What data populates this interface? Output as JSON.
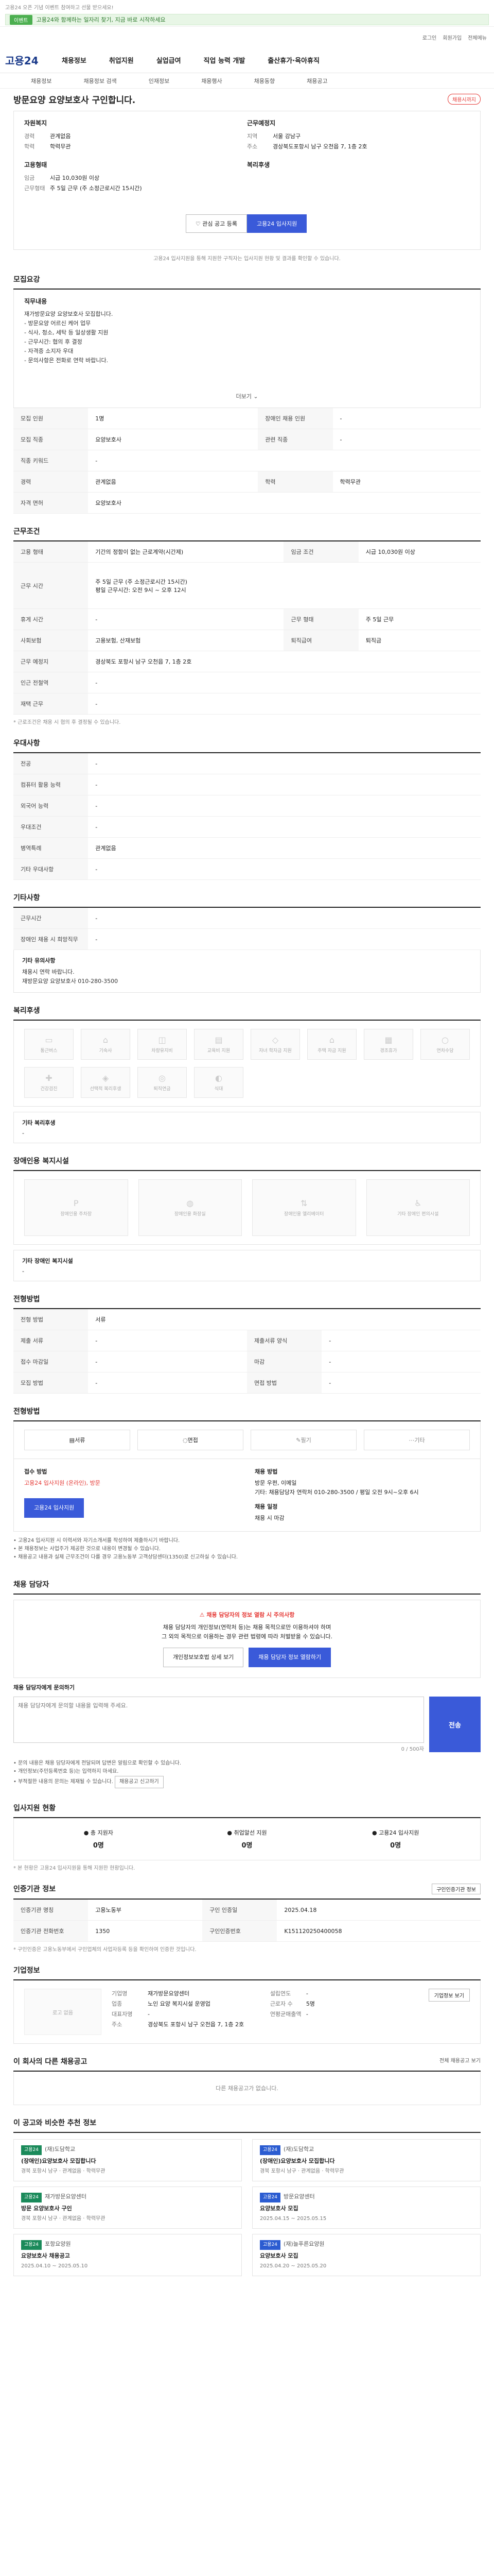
{
  "banner": {
    "notice": "고용24 오픈 기념 이벤트 참여하고 선물 받으세요!",
    "tag": "이벤트",
    "text": "고용24와 함께하는 일자리 찾기, 지금 바로 시작하세요"
  },
  "util": {
    "login": "로그인",
    "join": "회원가입",
    "sitemap": "전체메뉴"
  },
  "gnb": {
    "logo": "고용24",
    "menu": [
      "채용정보",
      "취업지원",
      "실업급여",
      "직업 능력 개발",
      "출산휴가·육아휴직"
    ],
    "sub": [
      "채용정보",
      "채용정보 검색",
      "인재정보",
      "채용행사",
      "채용동향",
      "채용공고"
    ]
  },
  "job": {
    "title": "방문요양 요양보호사 구인합니다.",
    "badge": "채용시까지",
    "left_head": "자원복지",
    "left": [
      {
        "k": "경력",
        "v": "관계없음"
      },
      {
        "k": "학력",
        "v": "학력무관"
      }
    ],
    "left_head2": "고용형태",
    "left2": [
      {
        "k": "임금",
        "v": "시급 10,030원 이상"
      },
      {
        "k": "근무형태",
        "v": "주 5일 근무 (주 소정근로시간 15시간)"
      }
    ],
    "right_head": "근무예정지",
    "right": [
      {
        "k": "지역",
        "v": "서울 강남구"
      },
      {
        "k": "주소",
        "v": "경상북도포항시 남구 오천읍 7, 1층 2호"
      }
    ],
    "right_head2": "복리후생",
    "apply_save": "관심 공고 등록",
    "apply_now": "고용24 입사지원",
    "note": "고용24 입사지원을 통해 지원한 구직자는 입사지원 현황 및 결과를 확인할 수 있습니다."
  },
  "section_titles": {
    "detail": "모집요강",
    "condition": "근무조건",
    "special": "우대사항",
    "other": "기타사항",
    "welfare": "복리후생",
    "infra": "장애인용 복지시설",
    "process": "전형방법",
    "contact": "채용 담당자",
    "stats": "입사지원 현황",
    "recruit_info": "인증기관 정보",
    "company": "기업정보",
    "company_jobs": "이 회사의 다른 채용공고",
    "recommend": "이 공고와 비슷한 추천 정보"
  },
  "detail": {
    "sub": "직무내용",
    "text": "재가방문요양 요양보호사 모집합니다.\n - 방문요양 어르신 케어 업무\n - 식사, 청소, 세탁 등 일상생활 지원\n - 근무시간: 협의 후 결정\n - 자격증 소지자 우대\n - 문의사항은 전화로 연락 바랍니다.",
    "more": "더보기",
    "rows": [
      {
        "k": "모집 인원",
        "v": "1명",
        "k2": "장애인 채용 인원",
        "v2": "-"
      },
      {
        "k": "모집 직종",
        "v": "요양보호사",
        "k2": "관련 직종",
        "v2": "-"
      },
      {
        "k": "직종 키워드",
        "v": "-",
        "k2": "",
        "v2": ""
      },
      {
        "k": "경력",
        "v": "관계없음",
        "k2": "학력",
        "v2": "학력무관"
      },
      {
        "k": "자격 면허",
        "v": "요양보호사",
        "k2": "",
        "v2": ""
      }
    ]
  },
  "condition": {
    "rows": [
      {
        "k": "고용 형태",
        "v": "기간의 정함이 없는 근로계약(시간제)",
        "k2": "임금 조건",
        "v2": "시급 10,030원 이상"
      },
      {
        "k": "근무 시간",
        "v": "주 5일 근무 (주 소정근로시간 15시간)\n평일 근무시간: 오전 9시 ~ 오후 12시",
        "k2": "",
        "v2": ""
      },
      {
        "k": "휴게 시간",
        "v": "-",
        "k2": "근무 형태",
        "v2": "주 5일 근무"
      },
      {
        "k": "사회보험",
        "v": "고용보험, 산재보험",
        "k2": "퇴직급여",
        "v2": "퇴직금"
      },
      {
        "k": "근무 예정지",
        "v": "경상북도 포항시 남구 오천읍 7, 1층 2호",
        "k2": "",
        "v2": ""
      },
      {
        "k": "인근 전철역",
        "v": "-",
        "k2": "",
        "v2": ""
      },
      {
        "k": "재택 근무",
        "v": "-",
        "k2": "",
        "v2": ""
      }
    ],
    "note": "* 근로조건은 채용 시 협의 후 결정될 수 있습니다."
  },
  "special": {
    "rows": [
      {
        "k": "전공",
        "v": "-"
      },
      {
        "k": "컴퓨터 활용 능력",
        "v": "-"
      },
      {
        "k": "외국어 능력",
        "v": "-"
      },
      {
        "k": "우대조건",
        "v": "-"
      },
      {
        "k": "병역특례",
        "v": "관계없음"
      },
      {
        "k": "기타 우대사항",
        "v": "-"
      }
    ]
  },
  "other": {
    "rows": [
      {
        "k": "근무시간",
        "v": "-"
      },
      {
        "k": "장애인 채용 시 희망직무",
        "v": "-"
      }
    ],
    "extra_label": "기타 유의사항",
    "extra_text": "채용시 연락 바랍니다.\n재방문요양 요양보호사 010-280-3500"
  },
  "welfare": {
    "items": [
      "통근버스",
      "기숙사",
      "차량유지비",
      "교육비 지원",
      "자녀 학자금 지원",
      "주택 자금 지원",
      "경조휴가",
      "연차수당",
      "건강검진",
      "선택적 복리후생",
      "퇴직연금",
      "식대"
    ],
    "etc_label": "기타 복리후생",
    "etc": "-"
  },
  "infra": {
    "items": [
      "장애인용 주차장",
      "장애인용 화장실",
      "장애인용 엘리베이터",
      "기타 장애인 편의시설"
    ],
    "etc_label": "기타 장애인 복지시설",
    "etc": "-"
  },
  "process_rows": [
    {
      "k": "전형 방법",
      "v": "서류",
      "k2": "",
      "v2": ""
    },
    {
      "k": "제출 서류",
      "v": "-",
      "k2": "제출서류 양식",
      "v2": "-"
    },
    {
      "k": "접수 마감일",
      "v": "-",
      "k2": "마감",
      "v2": "-"
    },
    {
      "k": "모집 방법",
      "v": "-",
      "k2": "면접 방법",
      "v2": "-"
    }
  ],
  "process": {
    "steps": [
      "서류",
      "면접",
      "필기",
      "기타"
    ],
    "apply_method_label": "접수 방법",
    "apply_method": "고용24 입사지원 (온라인), 방문",
    "apply_btn": "고용24 입사지원",
    "submit_label": "채용 방법",
    "submit": "방문 우편, 이메일\n기타: 채용담당자 연락처 010-280-3500 / 평일 오전 9시~오후 6시",
    "date_label": "채용 일정",
    "date": "채용 시 마감",
    "bullets": [
      "고용24 입사지원 시 이력서와 자기소개서를 작성하여 제출하시기 바랍니다.",
      "본 채용정보는 사업주가 제공한 것으로 내용이 변경될 수 있습니다.",
      "채용공고 내용과 실제 근무조건이 다를 경우 고용노동부 고객상담센터(1350)로 신고하실 수 있습니다."
    ]
  },
  "contact": {
    "alert_title": "채용 담당자의 정보 열람 시 주의사항",
    "alert_text": "채용 담당자의 개인정보(연락처 등)는 채용 목적으로만 이용하셔야 하며\n그 외의 목적으로 이용하는 경우 관련 법령에 따라 처벌받을 수 있습니다.",
    "btn1": "개인정보보호법 상세 보기",
    "btn2": "채용 담당자 정보 열람하기",
    "inq_label": "채용 담당자에게 문의하기",
    "inq_placeholder": "채용 담당자에게 문의할 내용을 입력해 주세요.",
    "counter": "0 / 500자",
    "send": "전송",
    "bullets": [
      "문의 내용은 채용 담당자에게 전달되며 답변은 알림으로 확인할 수 있습니다.",
      "개인정보(주민등록번호 등)는 입력하지 마세요.",
      "부적절한 내용의 문의는 제재될 수 있습니다."
    ],
    "report_btn": "채용공고 신고하기"
  },
  "stats": [
    {
      "label": "총 지원자",
      "value": "0명"
    },
    {
      "label": "취업알선 지원",
      "value": "0명"
    },
    {
      "label": "고용24 입사지원",
      "value": "0명"
    }
  ],
  "stats_note": "* 본 현황은 고용24 입사지원을 통해 지원한 현황입니다.",
  "recruit": {
    "btn": "구인인증기관 정보",
    "rows": [
      {
        "k": "인증기관 명칭",
        "v": "고용노동부",
        "k2": "구인 인증일",
        "v2": "2025.04.18"
      },
      {
        "k": "인증기관 전화번호",
        "v": "1350",
        "k2": "구인인증번호",
        "v2": "K151120250400058"
      }
    ],
    "note": "* 구인인증은 고용노동부에서 구인업체의 사업자등록 등을 확인하여 인증한 것입니다."
  },
  "company": {
    "logo": "로고 없음",
    "btn": "기업정보 보기",
    "rows": [
      {
        "k": "기업명",
        "v": "재가방문요양센터"
      },
      {
        "k": "업종",
        "v": "노인 요양 복지시설 운영업"
      },
      {
        "k": "대표자명",
        "v": "-"
      },
      {
        "k": "설립연도",
        "v": "-"
      },
      {
        "k": "근로자 수",
        "v": "5명"
      },
      {
        "k": "연평균매출액",
        "v": "-"
      }
    ],
    "addr_label": "주소",
    "addr": "경상북도 포항시 남구 오천읍 7, 1층 2호"
  },
  "company_jobs_empty": "다른 채용공고가 없습니다.",
  "company_jobs_more": "전체 채용공고 보기",
  "recommend": [
    {
      "tag": "고용24",
      "org": "(재)도담학교",
      "title": "(장애인)요양보호사 모집합니다",
      "meta": "경북 포항시 남구 · 관계없음 · 학력무관"
    },
    {
      "tag": "고용24",
      "org": "(재)도담학교",
      "title": "(장애인)요양보호사 모집합니다",
      "meta": "경북 포항시 남구 · 관계없음 · 학력무관"
    },
    {
      "tag": "고용24",
      "org": "재가방문요양센터",
      "title": "방문 요양보호사 구인",
      "meta": "경북 포항시 남구 · 관계없음 · 학력무관"
    },
    {
      "tag": "고용24",
      "org": "방문요양센터",
      "title": "요양보호사 모집",
      "meta": "2025.04.15 ~ 2025.05.15"
    },
    {
      "tag": "고용24",
      "org": "포항요양원",
      "title": "요양보호사 채용공고",
      "meta": "2025.04.10 ~ 2025.05.10"
    },
    {
      "tag": "고용24",
      "org": "(재)늘푸른요양원",
      "title": "요양보호사 모집",
      "meta": "2025.04.20 ~ 2025.05.20"
    }
  ]
}
